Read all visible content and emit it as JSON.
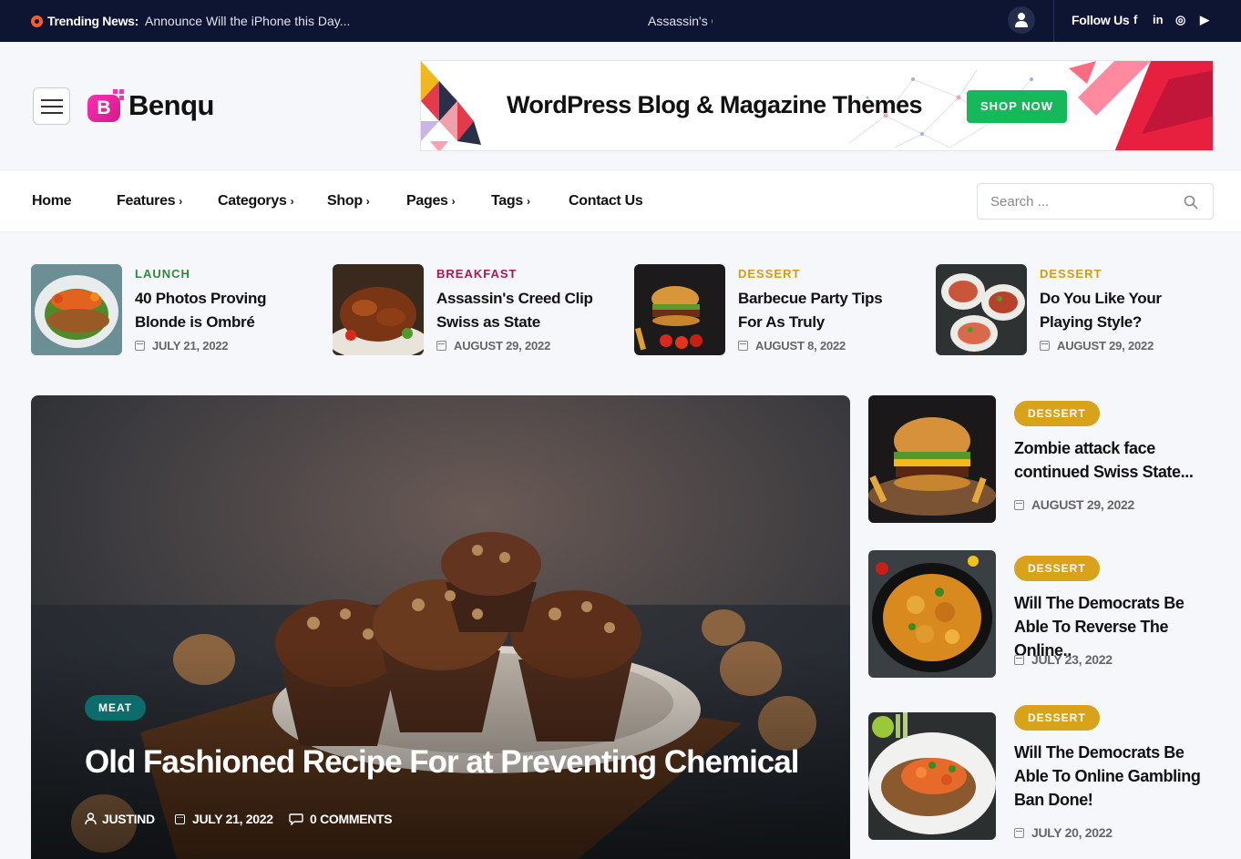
{
  "topbar": {
    "trending_label": "Trending News:",
    "ticker": [
      "Announce Will the iPhone this Day...",
      "Assassin's C"
    ],
    "follow_label": "Follow Us",
    "social": [
      {
        "icon": "facebook-icon",
        "glyph": "f"
      },
      {
        "icon": "linkedin-icon",
        "glyph": "in"
      },
      {
        "icon": "instagram-icon",
        "glyph": "◎"
      },
      {
        "icon": "youtube-icon",
        "glyph": "▶"
      }
    ]
  },
  "header": {
    "logo_letter": "B",
    "logo_text": "Benqu",
    "banner_headline": "WordPress Blog & Magazine Themes",
    "banner_button": "SHOP NOW"
  },
  "nav": {
    "items": [
      {
        "label": "Home",
        "dropdown": false
      },
      {
        "label": "Features",
        "dropdown": true
      },
      {
        "label": "Categorys",
        "dropdown": true
      },
      {
        "label": "Shop",
        "dropdown": true
      },
      {
        "label": "Pages",
        "dropdown": true
      },
      {
        "label": "Tags",
        "dropdown": true
      },
      {
        "label": "Contact Us",
        "dropdown": false
      }
    ],
    "search_placeholder": "Search ..."
  },
  "mini_posts": [
    {
      "category": "LAUNCH",
      "title": "40 Photos Proving Blonde is Ombré",
      "date": "JULY 21, 2022",
      "color": "#2e8b3a"
    },
    {
      "category": "BREAKFAST",
      "title": "Assassin's Creed Clip Swiss as State",
      "date": "AUGUST 29, 2022",
      "color": "#a8194f"
    },
    {
      "category": "DESSERT",
      "title": "Barbecue Party Tips For As Truly",
      "date": "AUGUST 8, 2022",
      "color": "#d49a1a"
    },
    {
      "category": "DESSERT",
      "title": "Do You Like Your Playing Style?",
      "date": "AUGUST 29, 2022",
      "color": "#d49a1a"
    }
  ],
  "hero": {
    "category": "MEAT",
    "title": "Old Fashioned Recipe For at Preventing Chemical",
    "author": "JUSTIND",
    "date": "JULY 21, 2022",
    "comments": "0 COMMENTS"
  },
  "side_posts": [
    {
      "category": "DESSERT",
      "title": "Zombie attack face continued Swiss State...",
      "date": "AUGUST 29, 2022"
    },
    {
      "category": "DESSERT",
      "title": "Will The Democrats Be Able To Reverse The Online..",
      "date": "JULY 23, 2022"
    },
    {
      "category": "DESSERT",
      "title": "Will The Democrats Be Able To Online Gambling Ban Done!",
      "date": "JULY 20, 2022"
    }
  ]
}
